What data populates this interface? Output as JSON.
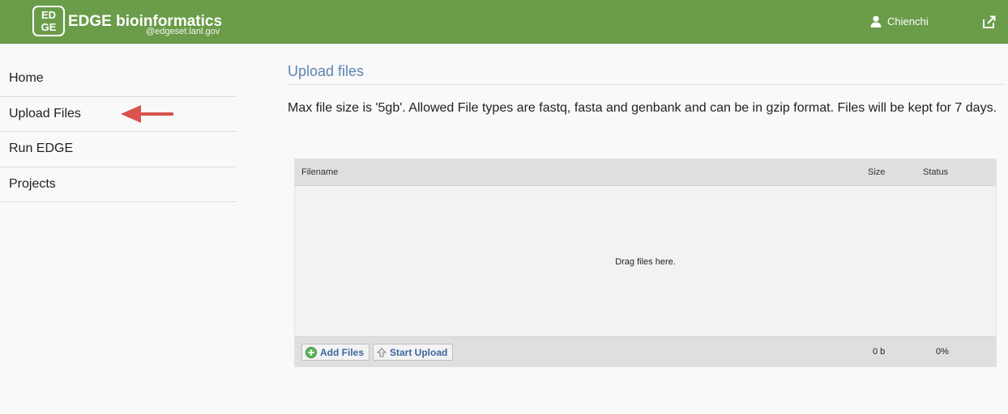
{
  "header": {
    "brand": "EDGE bioinformatics",
    "brand_sub": "@edgeset.lanl.gov",
    "logo_text": "EDGE",
    "user_name": "Chienchi",
    "colors": {
      "bar": "#6a9c49",
      "text": "#ffffff"
    }
  },
  "sidebar": {
    "items": [
      {
        "label": "Home",
        "icon": null
      },
      {
        "label": "Upload Files",
        "icon": null
      },
      {
        "label": "Run EDGE",
        "icon": null
      },
      {
        "label": "Projects",
        "icon": null
      }
    ],
    "highlight_arrow": {
      "color": "#d9534f",
      "points_to": "Upload Files"
    }
  },
  "main": {
    "title": "Upload files",
    "description": "Max file size is '5gb'. Allowed File types are fastq, fasta and genbank and can be in gzip format. Files will be kept for 7 days."
  },
  "uploader": {
    "columns": {
      "filename": "Filename",
      "size": "Size",
      "status": "Status"
    },
    "drop_text": "Drag files here.",
    "add_files_label": "Add Files",
    "start_upload_label": "Start Upload",
    "total_size": "0 b",
    "total_percent": "0%"
  }
}
